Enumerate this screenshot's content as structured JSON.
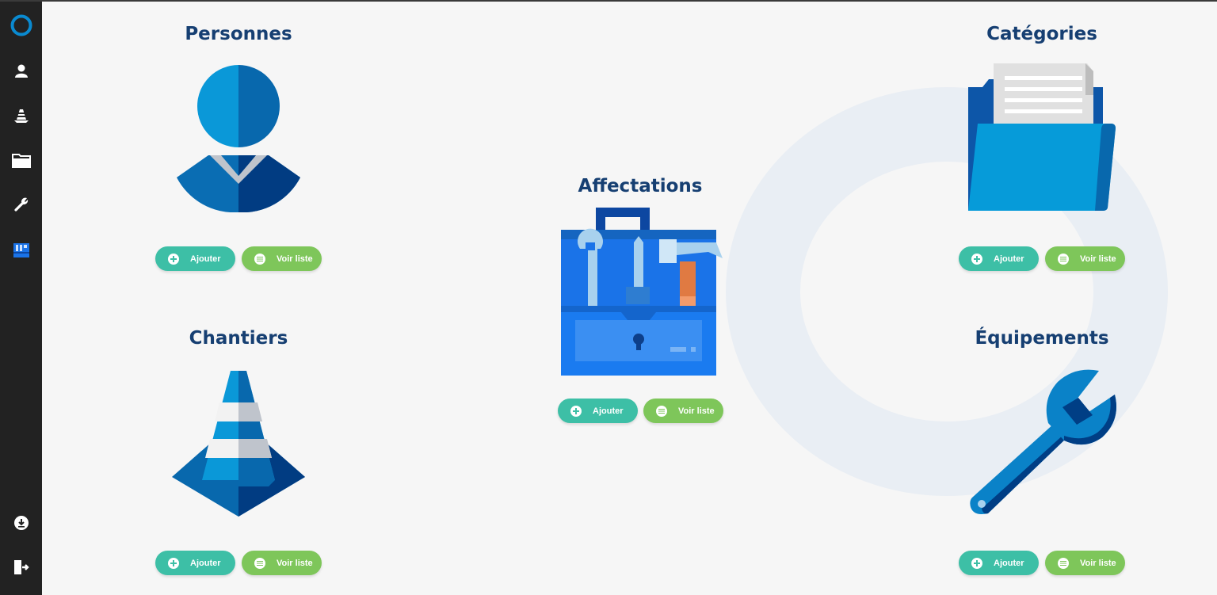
{
  "sidebar": {
    "items": [
      {
        "name": "logo",
        "icon": "ring-logo-icon"
      },
      {
        "name": "persons",
        "icon": "user-icon"
      },
      {
        "name": "sites",
        "icon": "traffic-cone-icon"
      },
      {
        "name": "categories",
        "icon": "folder-icon"
      },
      {
        "name": "equipment",
        "icon": "wrench-icon"
      },
      {
        "name": "assignments",
        "icon": "toolbox-icon"
      },
      {
        "name": "download",
        "icon": "download-icon"
      },
      {
        "name": "logout",
        "icon": "logout-icon"
      }
    ]
  },
  "cards": {
    "personnes": {
      "title": "Personnes",
      "icon": "person-icon",
      "add_label": "Ajouter",
      "list_label": "Voir liste"
    },
    "chantiers": {
      "title": "Chantiers",
      "icon": "traffic-cone-icon",
      "add_label": "Ajouter",
      "list_label": "Voir liste"
    },
    "affectations": {
      "title": "Affectations",
      "icon": "toolbox-icon",
      "add_label": "Ajouter",
      "list_label": "Voir liste"
    },
    "categories": {
      "title": "Catégories",
      "icon": "folder-icon",
      "add_label": "Ajouter",
      "list_label": "Voir liste"
    },
    "equipements": {
      "title": "Équipements",
      "icon": "wrench-icon",
      "add_label": "Ajouter",
      "list_label": "Voir liste"
    }
  },
  "colors": {
    "sidebar": "#222222",
    "title": "#163f72",
    "add_button": "#3dbfa6",
    "list_button": "#7ec65a",
    "icon_blue": "#0a8ad0",
    "icon_dark": "#003e85"
  }
}
